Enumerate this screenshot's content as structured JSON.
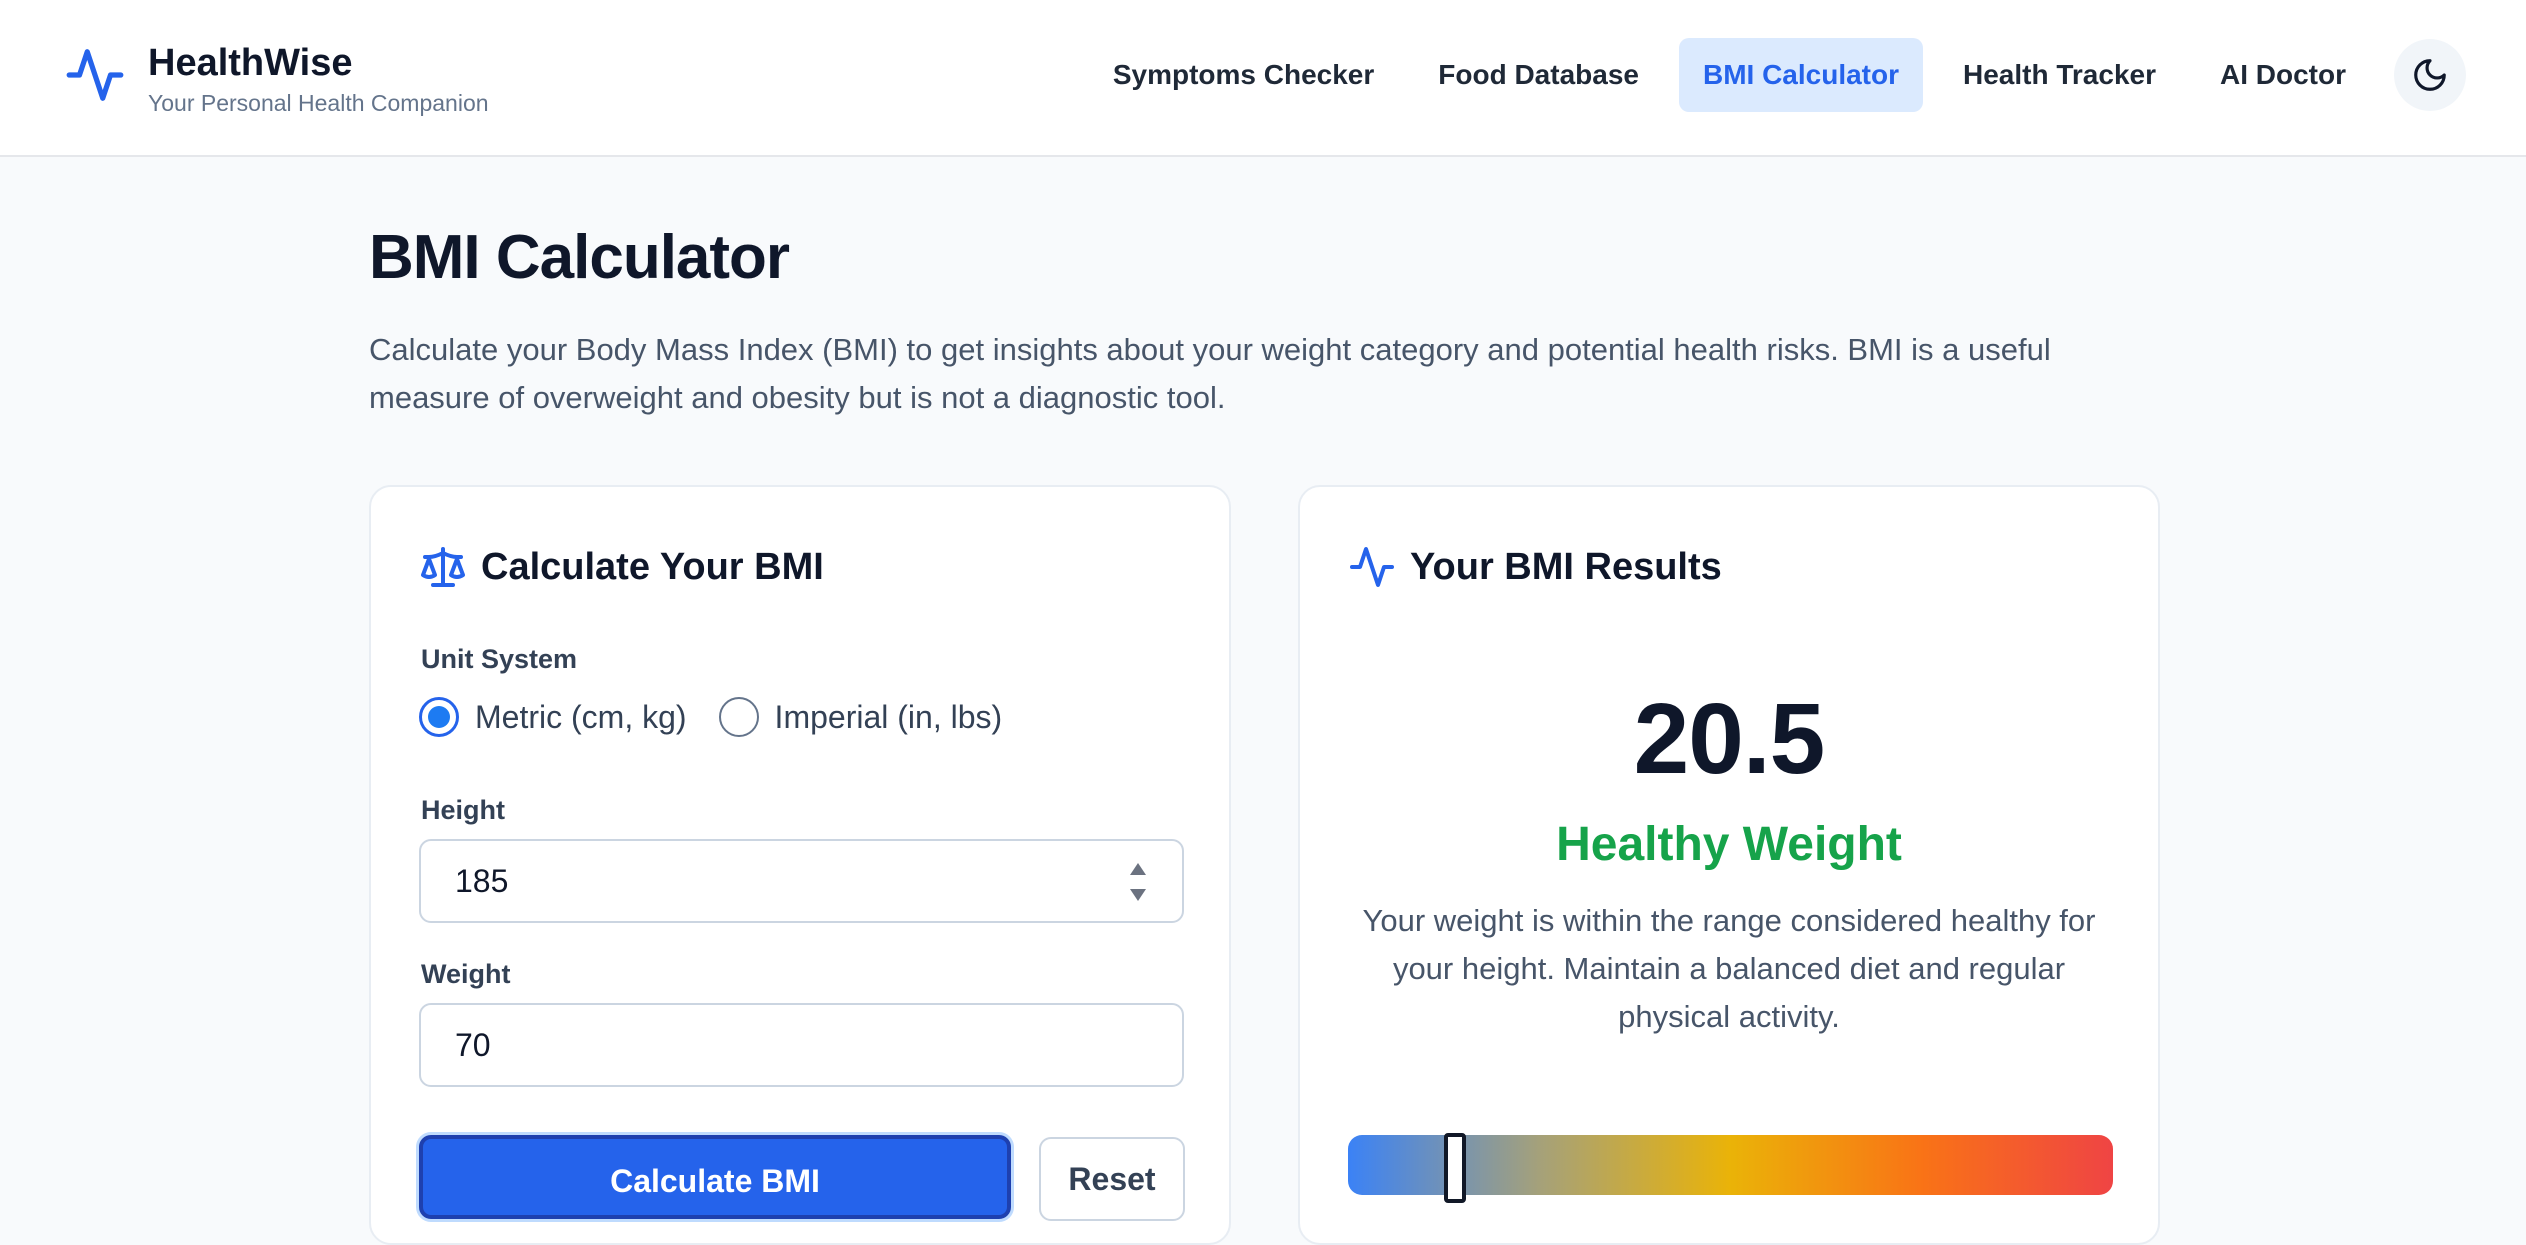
{
  "header": {
    "brand_title": "HealthWise",
    "brand_subtitle": "Your Personal Health Companion",
    "brand_icon": "activity-pulse-icon",
    "nav": [
      {
        "label": "Symptoms Checker",
        "active": false
      },
      {
        "label": "Food Database",
        "active": false
      },
      {
        "label": "BMI Calculator",
        "active": true
      },
      {
        "label": "Health Tracker",
        "active": false
      },
      {
        "label": "AI Doctor",
        "active": false
      }
    ],
    "theme_toggle_icon": "moon-icon"
  },
  "page": {
    "title": "BMI Calculator",
    "description": "Calculate your Body Mass Index (BMI) to get insights about your weight category and potential health risks. BMI is a useful measure of overweight and obesity but is not a diagnostic tool."
  },
  "calculator": {
    "title": "Calculate Your BMI",
    "icon": "scale-icon",
    "unit_system_label": "Unit System",
    "units": [
      {
        "label": "Metric (cm, kg)",
        "checked": true
      },
      {
        "label": "Imperial (in, lbs)",
        "checked": false
      }
    ],
    "height_label": "Height",
    "height_value": "185",
    "weight_label": "Weight",
    "weight_value": "70",
    "calculate_label": "Calculate BMI",
    "reset_label": "Reset"
  },
  "results": {
    "title": "Your BMI Results",
    "icon": "activity-pulse-icon",
    "bmi_value": "20.5",
    "category": "Healthy Weight",
    "category_color": "#16a34a",
    "description": "Your weight is within the range considered healthy for your height. Maintain a balanced diet and regular physical activity.",
    "scale_marker_fraction": 0.14
  },
  "colors": {
    "accent": "#2563eb",
    "active_nav_bg": "#dbeafe"
  }
}
